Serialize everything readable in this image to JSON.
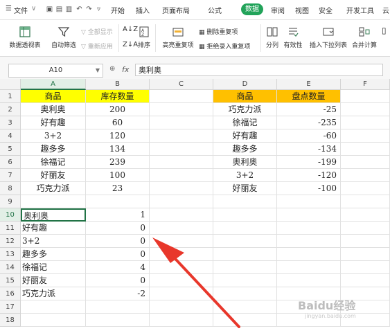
{
  "menu": {
    "file_label": "文件",
    "tabs": [
      "开始",
      "插入",
      "页面布局",
      "公式",
      "数据",
      "审阅",
      "视图",
      "安全",
      "开发工具",
      "云"
    ],
    "active_tab": "数据"
  },
  "ribbon": {
    "pivot": "数据透视表",
    "autofilter": "自动筛选",
    "show_all": "全部显示",
    "reapply": "重新应用",
    "sort": "排序",
    "highlight_dup": "高亮重复项",
    "delete_dup": "删除重复项",
    "reject_dup": "拒绝录入重复项",
    "split": "分列",
    "validity": "有效性",
    "dropdown_list": "插入下拉列表",
    "consolidate": "合并计算"
  },
  "formula_bar": {
    "name_box": "A10",
    "fx": "fx",
    "content": "奥利奥"
  },
  "columns": [
    "A",
    "B",
    "C",
    "D",
    "E",
    "F"
  ],
  "rows": [
    "1",
    "2",
    "3",
    "4",
    "5",
    "6",
    "7",
    "8",
    "9",
    "10",
    "11",
    "12",
    "13",
    "14",
    "15",
    "16",
    "17",
    "18"
  ],
  "table1": {
    "header": [
      "商品",
      "库存数量"
    ],
    "rows": [
      [
        "奥利奥",
        "200"
      ],
      [
        "好有趣",
        "60"
      ],
      [
        "3+2",
        "120"
      ],
      [
        "趣多多",
        "134"
      ],
      [
        "徐福记",
        "239"
      ],
      [
        "好丽友",
        "100"
      ],
      [
        "巧克力派",
        "23"
      ]
    ]
  },
  "table2": {
    "header": [
      "商品",
      "盘点数量"
    ],
    "rows": [
      [
        "巧克力派",
        "-25"
      ],
      [
        "徐福记",
        "-235"
      ],
      [
        "好有趣",
        "-60"
      ],
      [
        "趣多多",
        "-134"
      ],
      [
        "奥利奥",
        "-199"
      ],
      [
        "3+2",
        "-120"
      ],
      [
        "好丽友",
        "-100"
      ]
    ]
  },
  "table3": {
    "rows": [
      [
        "奥利奥",
        "1"
      ],
      [
        "好有趣",
        "0"
      ],
      [
        "3+2",
        "0"
      ],
      [
        "趣多多",
        "0"
      ],
      [
        "徐福记",
        "4"
      ],
      [
        "好丽友",
        "0"
      ],
      [
        "巧克力派",
        "-2"
      ]
    ]
  },
  "colors": {
    "header_yellow": "#ffff00",
    "header_orange": "#ffc000",
    "accent_green": "#22a35a",
    "arrow_red": "#e8372b"
  },
  "watermark": "Baidu经验",
  "watermark_sub": "jingyan.baidu.com"
}
